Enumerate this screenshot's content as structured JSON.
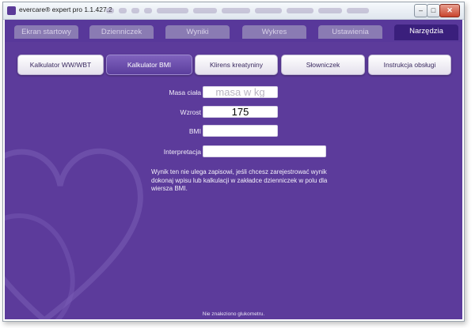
{
  "window": {
    "title": "evercare® expert pro 1.1.427.2",
    "controls": {
      "minimize": "–",
      "maximize": "□",
      "close": "✕"
    }
  },
  "tabs": [
    {
      "label": "Ekran startowy",
      "active": false
    },
    {
      "label": "Dzienniczek",
      "active": false
    },
    {
      "label": "Wyniki",
      "active": false
    },
    {
      "label": "Wykres",
      "active": false
    },
    {
      "label": "Ustawienia",
      "active": false
    },
    {
      "label": "Narzędzia",
      "active": true
    }
  ],
  "subtabs": [
    {
      "label": "Kalkulator WW/WBT",
      "active": false
    },
    {
      "label": "Kalkulator BMI",
      "active": true
    },
    {
      "label": "Klirens kreatyniny",
      "active": false
    },
    {
      "label": "Słowniczek",
      "active": false
    },
    {
      "label": "Instrukcja obsługi",
      "active": false
    }
  ],
  "form": {
    "weight": {
      "label": "Masa ciała",
      "value": "",
      "placeholder": "masa w kg"
    },
    "height": {
      "label": "Wzrost",
      "value": "175"
    },
    "bmi": {
      "label": "BMI",
      "value": ""
    },
    "interpretation": {
      "label": "Interpretacja",
      "value": ""
    }
  },
  "note": "Wynik ten nie ulega zapisowi, jeśli chcesz zarejestrować wynik dokonaj wpisu lub kalkulacji w zakładce dzienniczek w polu dla wiersza BMI.",
  "status": "Nie znaleziono glukometru.",
  "colors": {
    "background": "#5c3b9b",
    "active_tab": "#3a1f7c",
    "inactive_tab": "#8a7bb3"
  }
}
